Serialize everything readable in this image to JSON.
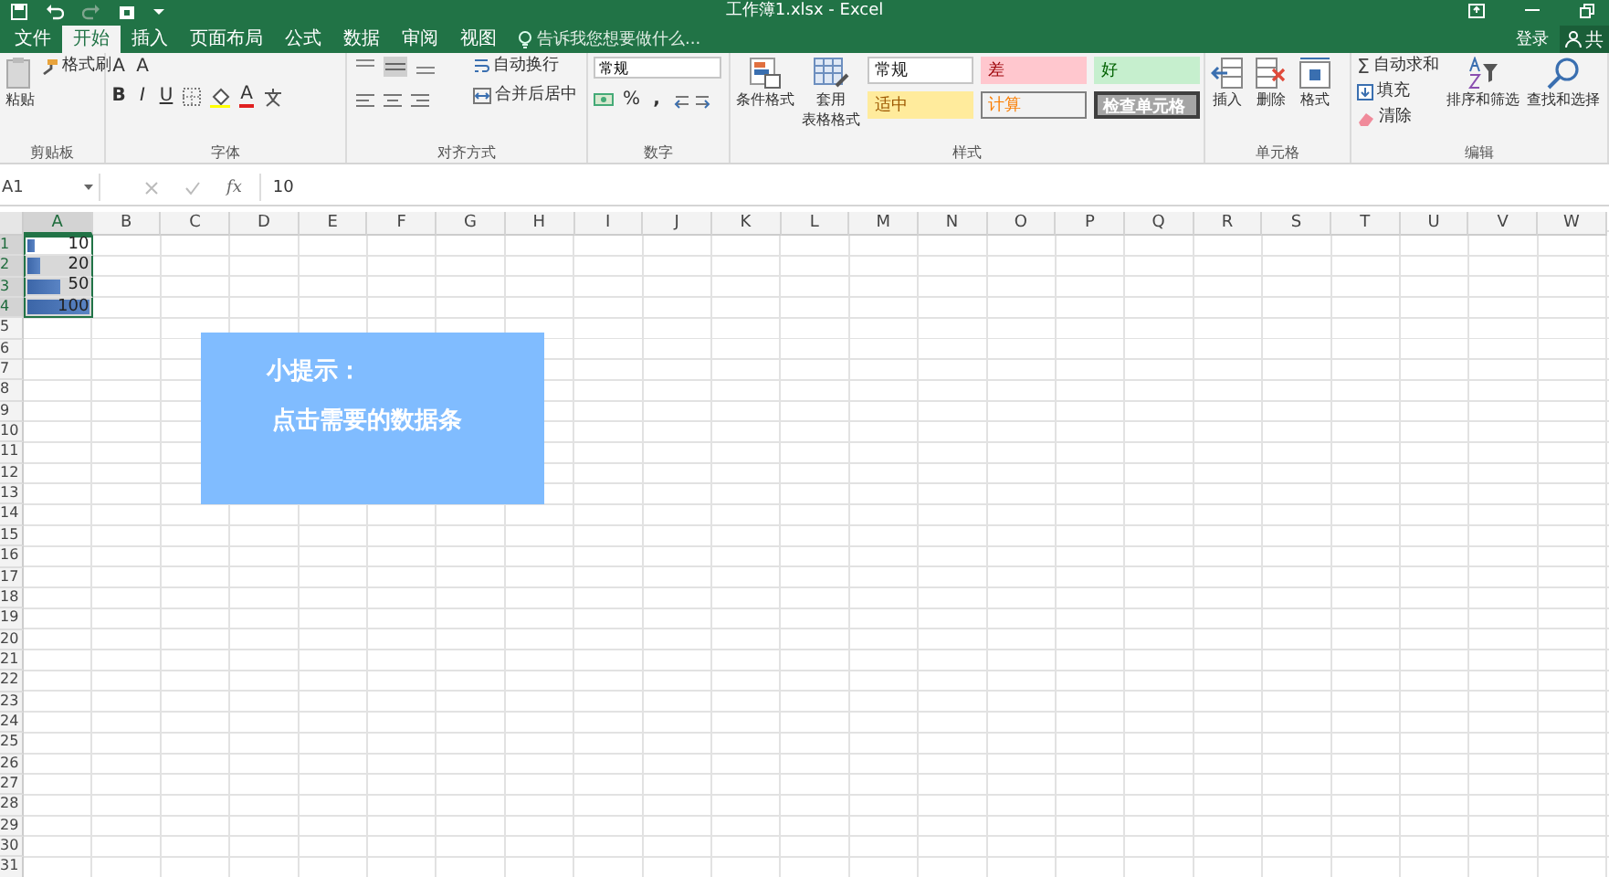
{
  "window": {
    "title": "工作簿1.xlsx - Excel",
    "account": "登录",
    "share": "共"
  },
  "tabs": [
    {
      "label": "文件",
      "selected": false
    },
    {
      "label": "开始",
      "selected": true
    },
    {
      "label": "插入",
      "selected": false
    },
    {
      "label": "页面布局",
      "selected": false
    },
    {
      "label": "公式",
      "selected": false
    },
    {
      "label": "数据",
      "selected": false
    },
    {
      "label": "审阅",
      "selected": false
    },
    {
      "label": "视图",
      "selected": false
    }
  ],
  "tell_me": {
    "placeholder": "告诉我您想要做什么..."
  },
  "clipboard": {
    "label": "剪贴板",
    "paste": "粘贴",
    "format_painter": "格式刷"
  },
  "font": {
    "label": "字体",
    "grow": "A",
    "shrink": "A",
    "bold": "B",
    "italic": "I",
    "underline": "U",
    "color_letter": "A"
  },
  "alignment": {
    "label": "对齐方式",
    "wrap": "自动换行",
    "merge": "合并后居中"
  },
  "number": {
    "label": "数字",
    "format": "常规",
    "percent": "%",
    "comma": ","
  },
  "styles": {
    "label": "样式",
    "conditional": "条件格式",
    "table": "套用",
    "table_2": "表格格式",
    "cells": [
      {
        "label": "常规",
        "kind": "normal"
      },
      {
        "label": "差",
        "kind": "bad"
      },
      {
        "label": "好",
        "kind": "good"
      },
      {
        "label": "适中",
        "kind": "neutral"
      },
      {
        "label": "计算",
        "kind": "calc"
      },
      {
        "label": "检查单元格",
        "kind": "check"
      }
    ]
  },
  "cells_group": {
    "label": "单元格",
    "buttons": [
      "插入",
      "删除",
      "格式"
    ]
  },
  "editing": {
    "label": "编辑",
    "sigma": "Σ",
    "autosum": "自动求和",
    "fill": "填充",
    "clear": "清除",
    "sort": "排序和筛选",
    "find": "查找和选择"
  },
  "formula_bar": {
    "name_box": "A1",
    "fx": "fx",
    "value": "10"
  },
  "sheet": {
    "columns": [
      "A",
      "B",
      "C",
      "D",
      "E",
      "F",
      "G",
      "H",
      "I",
      "J",
      "K",
      "L",
      "M",
      "N",
      "O",
      "P",
      "Q",
      "R",
      "S",
      "T",
      "U",
      "V",
      "W"
    ],
    "rows": [
      "1",
      "2",
      "3",
      "4",
      "5",
      "6",
      "7",
      "8",
      "9",
      "10",
      "11",
      "12",
      "13",
      "14",
      "15",
      "16",
      "17",
      "18",
      "19",
      "20",
      "21",
      "22",
      "23",
      "24",
      "25",
      "26",
      "27",
      "28",
      "29",
      "30",
      "31"
    ],
    "cells": [
      {
        "value": "10",
        "level": 0.1,
        "selected": true,
        "active": true
      },
      {
        "value": "20",
        "level": 0.2,
        "selected": true,
        "active": false
      },
      {
        "value": "50",
        "level": 0.5,
        "selected": true,
        "active": false
      },
      {
        "value": "100",
        "level": 1,
        "selected": true,
        "active": false
      }
    ]
  },
  "tip": {
    "title": "小提示：",
    "body": "点击需要的数据条"
  }
}
